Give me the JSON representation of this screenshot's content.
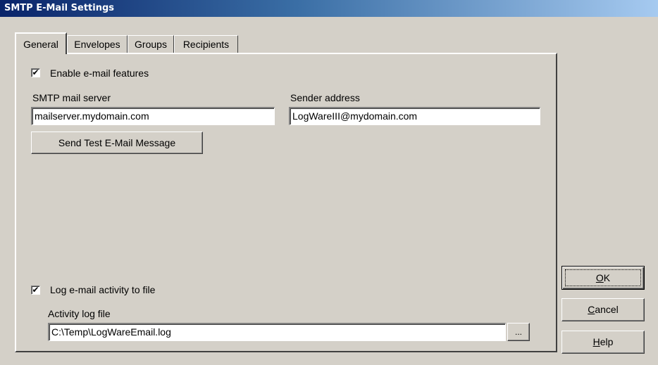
{
  "window": {
    "title": "SMTP E-Mail Settings"
  },
  "tabs": [
    {
      "label": "General",
      "active": true
    },
    {
      "label": "Envelopes",
      "active": false
    },
    {
      "label": "Groups",
      "active": false
    },
    {
      "label": "Recipients",
      "active": false
    }
  ],
  "general": {
    "enable_email": {
      "label": "Enable e-mail features",
      "checked": true
    },
    "smtp_server": {
      "label": "SMTP mail server",
      "value": "mailserver.mydomain.com"
    },
    "sender_address": {
      "label": "Sender address",
      "value": "LogWareIII@mydomain.com"
    },
    "send_test_label": "Send Test E-Mail Message",
    "log_activity": {
      "label": "Log e-mail activity to file",
      "checked": true
    },
    "activity_log_file": {
      "label": "Activity log file",
      "value": "C:\\Temp\\LogWareEmail.log",
      "browse_label": "..."
    }
  },
  "buttons": {
    "ok": {
      "mnemonic": "O",
      "rest": "K"
    },
    "cancel": {
      "mnemonic": "C",
      "rest": "ancel"
    },
    "help": {
      "mnemonic": "H",
      "rest": "elp"
    }
  },
  "check_glyph": "✔"
}
